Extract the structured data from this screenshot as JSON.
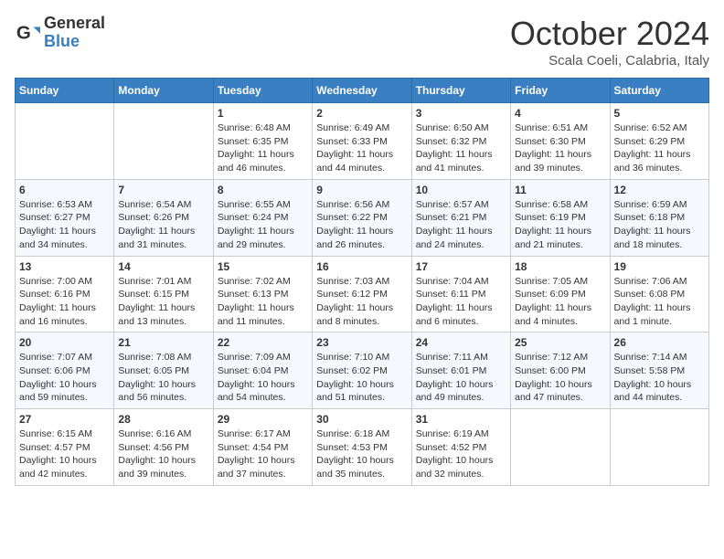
{
  "header": {
    "logo_line1": "General",
    "logo_line2": "Blue",
    "month": "October 2024",
    "location": "Scala Coeli, Calabria, Italy"
  },
  "days_of_week": [
    "Sunday",
    "Monday",
    "Tuesday",
    "Wednesday",
    "Thursday",
    "Friday",
    "Saturday"
  ],
  "weeks": [
    [
      {
        "day": "",
        "info": ""
      },
      {
        "day": "",
        "info": ""
      },
      {
        "day": "1",
        "info": "Sunrise: 6:48 AM\nSunset: 6:35 PM\nDaylight: 11 hours and 46 minutes."
      },
      {
        "day": "2",
        "info": "Sunrise: 6:49 AM\nSunset: 6:33 PM\nDaylight: 11 hours and 44 minutes."
      },
      {
        "day": "3",
        "info": "Sunrise: 6:50 AM\nSunset: 6:32 PM\nDaylight: 11 hours and 41 minutes."
      },
      {
        "day": "4",
        "info": "Sunrise: 6:51 AM\nSunset: 6:30 PM\nDaylight: 11 hours and 39 minutes."
      },
      {
        "day": "5",
        "info": "Sunrise: 6:52 AM\nSunset: 6:29 PM\nDaylight: 11 hours and 36 minutes."
      }
    ],
    [
      {
        "day": "6",
        "info": "Sunrise: 6:53 AM\nSunset: 6:27 PM\nDaylight: 11 hours and 34 minutes."
      },
      {
        "day": "7",
        "info": "Sunrise: 6:54 AM\nSunset: 6:26 PM\nDaylight: 11 hours and 31 minutes."
      },
      {
        "day": "8",
        "info": "Sunrise: 6:55 AM\nSunset: 6:24 PM\nDaylight: 11 hours and 29 minutes."
      },
      {
        "day": "9",
        "info": "Sunrise: 6:56 AM\nSunset: 6:22 PM\nDaylight: 11 hours and 26 minutes."
      },
      {
        "day": "10",
        "info": "Sunrise: 6:57 AM\nSunset: 6:21 PM\nDaylight: 11 hours and 24 minutes."
      },
      {
        "day": "11",
        "info": "Sunrise: 6:58 AM\nSunset: 6:19 PM\nDaylight: 11 hours and 21 minutes."
      },
      {
        "day": "12",
        "info": "Sunrise: 6:59 AM\nSunset: 6:18 PM\nDaylight: 11 hours and 18 minutes."
      }
    ],
    [
      {
        "day": "13",
        "info": "Sunrise: 7:00 AM\nSunset: 6:16 PM\nDaylight: 11 hours and 16 minutes."
      },
      {
        "day": "14",
        "info": "Sunrise: 7:01 AM\nSunset: 6:15 PM\nDaylight: 11 hours and 13 minutes."
      },
      {
        "day": "15",
        "info": "Sunrise: 7:02 AM\nSunset: 6:13 PM\nDaylight: 11 hours and 11 minutes."
      },
      {
        "day": "16",
        "info": "Sunrise: 7:03 AM\nSunset: 6:12 PM\nDaylight: 11 hours and 8 minutes."
      },
      {
        "day": "17",
        "info": "Sunrise: 7:04 AM\nSunset: 6:11 PM\nDaylight: 11 hours and 6 minutes."
      },
      {
        "day": "18",
        "info": "Sunrise: 7:05 AM\nSunset: 6:09 PM\nDaylight: 11 hours and 4 minutes."
      },
      {
        "day": "19",
        "info": "Sunrise: 7:06 AM\nSunset: 6:08 PM\nDaylight: 11 hours and 1 minute."
      }
    ],
    [
      {
        "day": "20",
        "info": "Sunrise: 7:07 AM\nSunset: 6:06 PM\nDaylight: 10 hours and 59 minutes."
      },
      {
        "day": "21",
        "info": "Sunrise: 7:08 AM\nSunset: 6:05 PM\nDaylight: 10 hours and 56 minutes."
      },
      {
        "day": "22",
        "info": "Sunrise: 7:09 AM\nSunset: 6:04 PM\nDaylight: 10 hours and 54 minutes."
      },
      {
        "day": "23",
        "info": "Sunrise: 7:10 AM\nSunset: 6:02 PM\nDaylight: 10 hours and 51 minutes."
      },
      {
        "day": "24",
        "info": "Sunrise: 7:11 AM\nSunset: 6:01 PM\nDaylight: 10 hours and 49 minutes."
      },
      {
        "day": "25",
        "info": "Sunrise: 7:12 AM\nSunset: 6:00 PM\nDaylight: 10 hours and 47 minutes."
      },
      {
        "day": "26",
        "info": "Sunrise: 7:14 AM\nSunset: 5:58 PM\nDaylight: 10 hours and 44 minutes."
      }
    ],
    [
      {
        "day": "27",
        "info": "Sunrise: 6:15 AM\nSunset: 4:57 PM\nDaylight: 10 hours and 42 minutes."
      },
      {
        "day": "28",
        "info": "Sunrise: 6:16 AM\nSunset: 4:56 PM\nDaylight: 10 hours and 39 minutes."
      },
      {
        "day": "29",
        "info": "Sunrise: 6:17 AM\nSunset: 4:54 PM\nDaylight: 10 hours and 37 minutes."
      },
      {
        "day": "30",
        "info": "Sunrise: 6:18 AM\nSunset: 4:53 PM\nDaylight: 10 hours and 35 minutes."
      },
      {
        "day": "31",
        "info": "Sunrise: 6:19 AM\nSunset: 4:52 PM\nDaylight: 10 hours and 32 minutes."
      },
      {
        "day": "",
        "info": ""
      },
      {
        "day": "",
        "info": ""
      }
    ]
  ]
}
